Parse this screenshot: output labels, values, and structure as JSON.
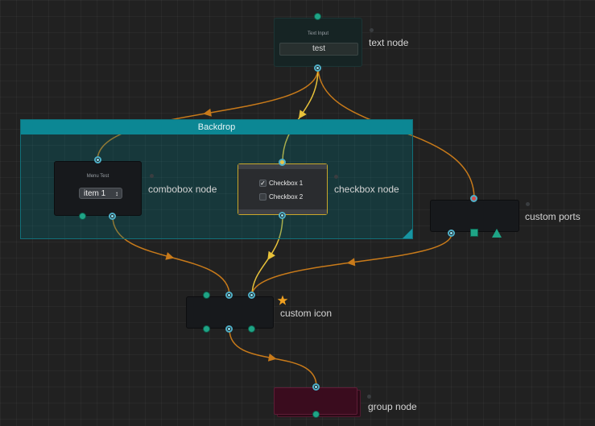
{
  "backdrop": {
    "title": "Backdrop"
  },
  "nodes": {
    "text_node": {
      "label": "text node",
      "widget_title": "Text Input",
      "value": "test"
    },
    "combobox_node": {
      "label": "combobox node",
      "widget_title": "Menu Test",
      "selected": "item 1"
    },
    "checkbox_node": {
      "label": "checkbox node",
      "checkboxes": [
        {
          "label": "Checkbox 1",
          "checked": true
        },
        {
          "label": "Checkbox 2",
          "checked": false
        }
      ]
    },
    "custom_ports": {
      "label": "custom ports"
    },
    "custom_icon": {
      "label": "custom icon",
      "icon": "star-icon"
    },
    "group_node": {
      "label": "group node"
    }
  },
  "colors": {
    "canvas": "#212121",
    "backdrop_header": "#0c8794",
    "wire_orange": "#c87a1a",
    "wire_yellow": "#e8c23a",
    "port_green": "#1fa486",
    "port_ring": "#4fb0c8",
    "star": "#f0a020",
    "group_node": "#3a0c1e"
  }
}
